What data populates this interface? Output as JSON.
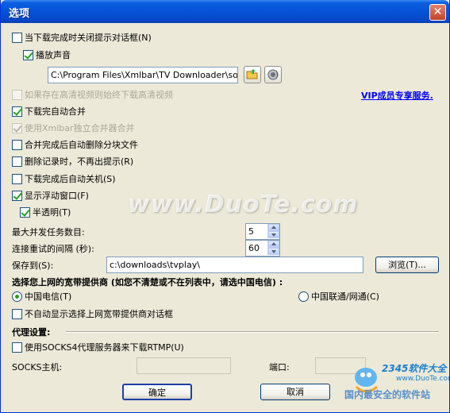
{
  "window": {
    "title": "选项",
    "close_glyph": "✕"
  },
  "options": {
    "close_prompt": "当下载完成时关闭提示对话框(N)",
    "play_sound": "播放声音",
    "sound_path": "C:\\Program Files\\Xmlbar\\TV Downloader\\sounds\\",
    "hd_video": "如果存在高清视频则始终下载高清视频",
    "vip_link": "VIP成员专享服务.",
    "auto_merge": "下载完自动合并",
    "use_merger": "使用Xmlbar独立合并器合并",
    "delete_parts": "合并完成后自动删除分块文件",
    "no_prompt_delete": "删除记录时，不再出提示(R)",
    "auto_shutdown": "下载完成后自动关机(S)",
    "show_float": "显示浮动窗口(F)",
    "semi_transparent": "半透明(T)"
  },
  "settings": {
    "max_tasks_label": "最大并发任务数目:",
    "max_tasks_value": "5",
    "retry_label": "连接重试的间隔 (秒):",
    "retry_value": "60",
    "save_label": "保存到(S):",
    "save_path": "c:\\downloads\\tvplay\\",
    "browse_label": "浏览(T)..."
  },
  "isp": {
    "heading": "选择您上网的宽带提供商 (如您不清楚或不在列表中，请选中国电信) :",
    "telecom": "中国电信(T)",
    "unicom": "中国联通/网通(C)",
    "no_auto_show": "不自动显示选择上网宽带提供商对话框"
  },
  "proxy": {
    "heading": "代理设置:",
    "use_socks": "使用SOCKS4代理服务器来下载RTMP(U)",
    "host_label": "SOCKS主机:",
    "host_value": "",
    "port_label": "端口:",
    "port_value": ""
  },
  "buttons": {
    "ok": "确定",
    "cancel": "取消"
  },
  "watermark": {
    "text": "www.DuoTe.com",
    "brand": "2345软件大全",
    "site": "www.DuoTe.com",
    "slogan": "国内最安全的软件站"
  },
  "colors": {
    "titlebar": "#0752D8",
    "dialog_bg": "#ECE9D8",
    "check_green": "#21A121",
    "link_blue": "#0000FF"
  }
}
